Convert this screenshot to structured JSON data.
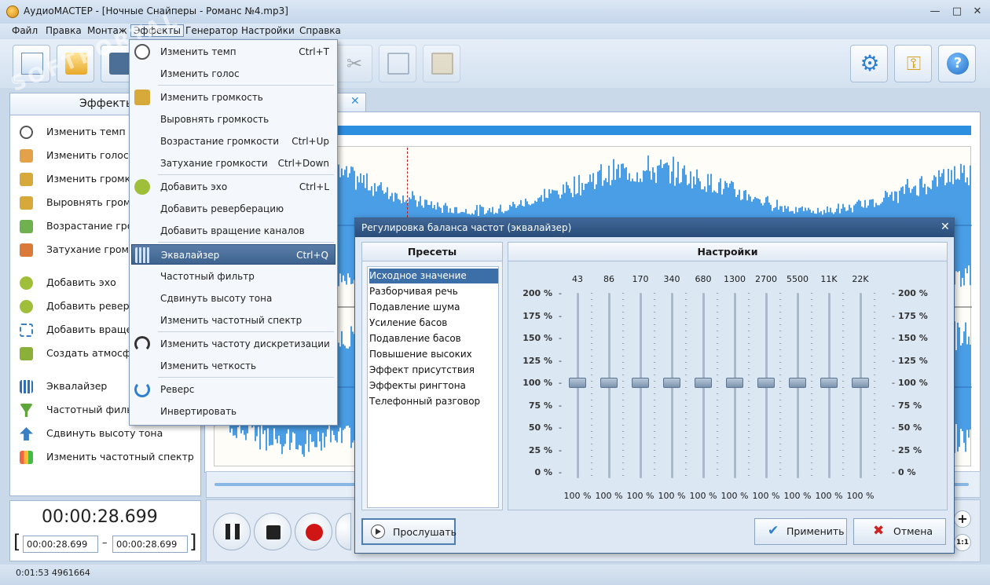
{
  "window": {
    "title": "АудиоМАСТЕР - [Ночные Снайперы - Романс №4.mp3]",
    "minimize": "—",
    "maximize": "□",
    "close": "✕"
  },
  "menubar": [
    "Файл",
    "Правка",
    "Монтаж",
    "Эффекты",
    "Генератор",
    "Настройки",
    "Справка"
  ],
  "watermark": "SOFTPORTAL",
  "left_panel": {
    "tab": "Эффекты",
    "items": [
      "Изменить темп",
      "Изменить голос",
      "Изменить громкость",
      "Выровнять громкость",
      "Возрастание громкости",
      "Затухание громкости",
      "Добавить эхо",
      "Добавить реверберацию",
      "Добавить вращение каналов",
      "Создать атмосферу",
      "Эквалайзер",
      "Частотный фильтр",
      "Сдвинуть высоту тона",
      "Изменить частотный спектр"
    ]
  },
  "time": {
    "current": "00:00:28.699",
    "start": "00:00:28.699",
    "end": "00:00:28.699",
    "separator": "–",
    "bracket_l": "[",
    "bracket_r": "]"
  },
  "status": "0:01:53 4961664",
  "zoom": {
    "plus": "+",
    "fit": "1:1"
  },
  "dropdown": {
    "items": [
      {
        "label": "Изменить темп",
        "shortcut": "Ctrl+T"
      },
      {
        "label": "Изменить голос",
        "shortcut": ""
      },
      {
        "label": "Изменить громкость",
        "shortcut": ""
      },
      {
        "label": "Выровнять громкость",
        "shortcut": ""
      },
      {
        "label": "Возрастание громкости",
        "shortcut": "Ctrl+Up"
      },
      {
        "label": "Затухание громкости",
        "shortcut": "Ctrl+Down"
      },
      {
        "label": "Добавить эхо",
        "shortcut": "Ctrl+L"
      },
      {
        "label": "Добавить реверберацию",
        "shortcut": ""
      },
      {
        "label": "Добавить вращение каналов",
        "shortcut": ""
      },
      {
        "label": "Эквалайзер",
        "shortcut": "Ctrl+Q"
      },
      {
        "label": "Частотный фильтр",
        "shortcut": ""
      },
      {
        "label": "Сдвинуть высоту тона",
        "shortcut": ""
      },
      {
        "label": "Изменить частотный спектр",
        "shortcut": ""
      },
      {
        "label": "Изменить частоту дискретизации",
        "shortcut": ""
      },
      {
        "label": "Изменить четкость",
        "shortcut": ""
      },
      {
        "label": "Реверс",
        "shortcut": ""
      },
      {
        "label": "Инвертировать",
        "shortcut": ""
      }
    ]
  },
  "dialog": {
    "title": "Регулировка баланса частот (эквалайзер)",
    "close": "✕",
    "presets_header": "Пресеты",
    "settings_header": "Настройки",
    "presets": [
      "Исходное значение",
      "Разборчивая речь",
      "Подавление шума",
      "Усиление басов",
      "Подавление басов",
      "Повышение высоких",
      "Эффект присутствия",
      "Эффекты рингтона",
      "Телефонный разговор"
    ],
    "selected_preset": 0,
    "frequencies": [
      "43",
      "86",
      "170",
      "340",
      "680",
      "1300",
      "2700",
      "5500",
      "11K",
      "22K"
    ],
    "scale": [
      "200 %",
      "175 %",
      "150 %",
      "125 %",
      "100 %",
      "75 %",
      "50 %",
      "25 %",
      "0 %"
    ],
    "band_values": [
      "100 %",
      "100 %",
      "100 %",
      "100 %",
      "100 %",
      "100 %",
      "100 %",
      "100 %",
      "100 %",
      "100 %"
    ],
    "band_levels": [
      100,
      100,
      100,
      100,
      100,
      100,
      100,
      100,
      100,
      100
    ],
    "buttons": {
      "listen": "Прослушать",
      "apply": "Применить",
      "cancel": "Отмена"
    }
  },
  "colors": {
    "waveform": "#4a9ee6",
    "selection": "#3e6390",
    "accent": "#2d8fe0"
  }
}
